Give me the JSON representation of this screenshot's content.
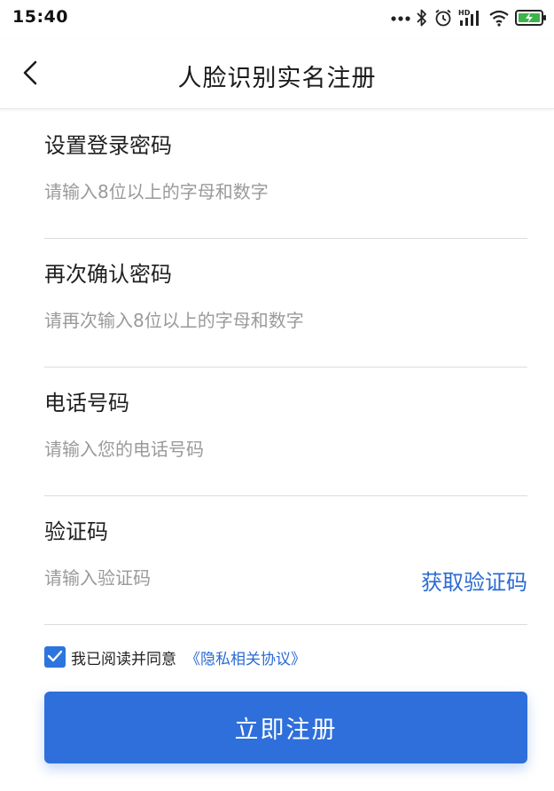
{
  "status_bar": {
    "time": "15:40",
    "icons": [
      "more-dots-icon",
      "bluetooth-icon",
      "alarm-icon",
      "hd-signal-icon",
      "wifi-icon",
      "battery-charging-icon"
    ],
    "hd_label": "HD"
  },
  "nav": {
    "title": "人脸识别实名注册",
    "back_icon": "chevron-left-icon"
  },
  "form": {
    "password": {
      "label": "设置登录密码",
      "value": "",
      "placeholder": "请输入8位以上的字母和数字"
    },
    "confirm_password": {
      "label": "再次确认密码",
      "value": "",
      "placeholder": "请再次输入8位以上的字母和数字"
    },
    "phone": {
      "label": "电话号码",
      "value": "",
      "placeholder": "请输入您的电话号码"
    },
    "code": {
      "label": "验证码",
      "value": "",
      "placeholder": "请输入验证码",
      "get_code_label": "获取验证码"
    }
  },
  "agreement": {
    "checked": true,
    "text": "我已阅读并同意",
    "link_text": "《隐私相关协议》"
  },
  "submit_label": "立即注册",
  "colors": {
    "primary": "#2e6fdb",
    "link": "#2b6ad3",
    "checkbox": "#2c74de",
    "divider": "#dcdcdc",
    "placeholder": "#9a9a9a"
  }
}
